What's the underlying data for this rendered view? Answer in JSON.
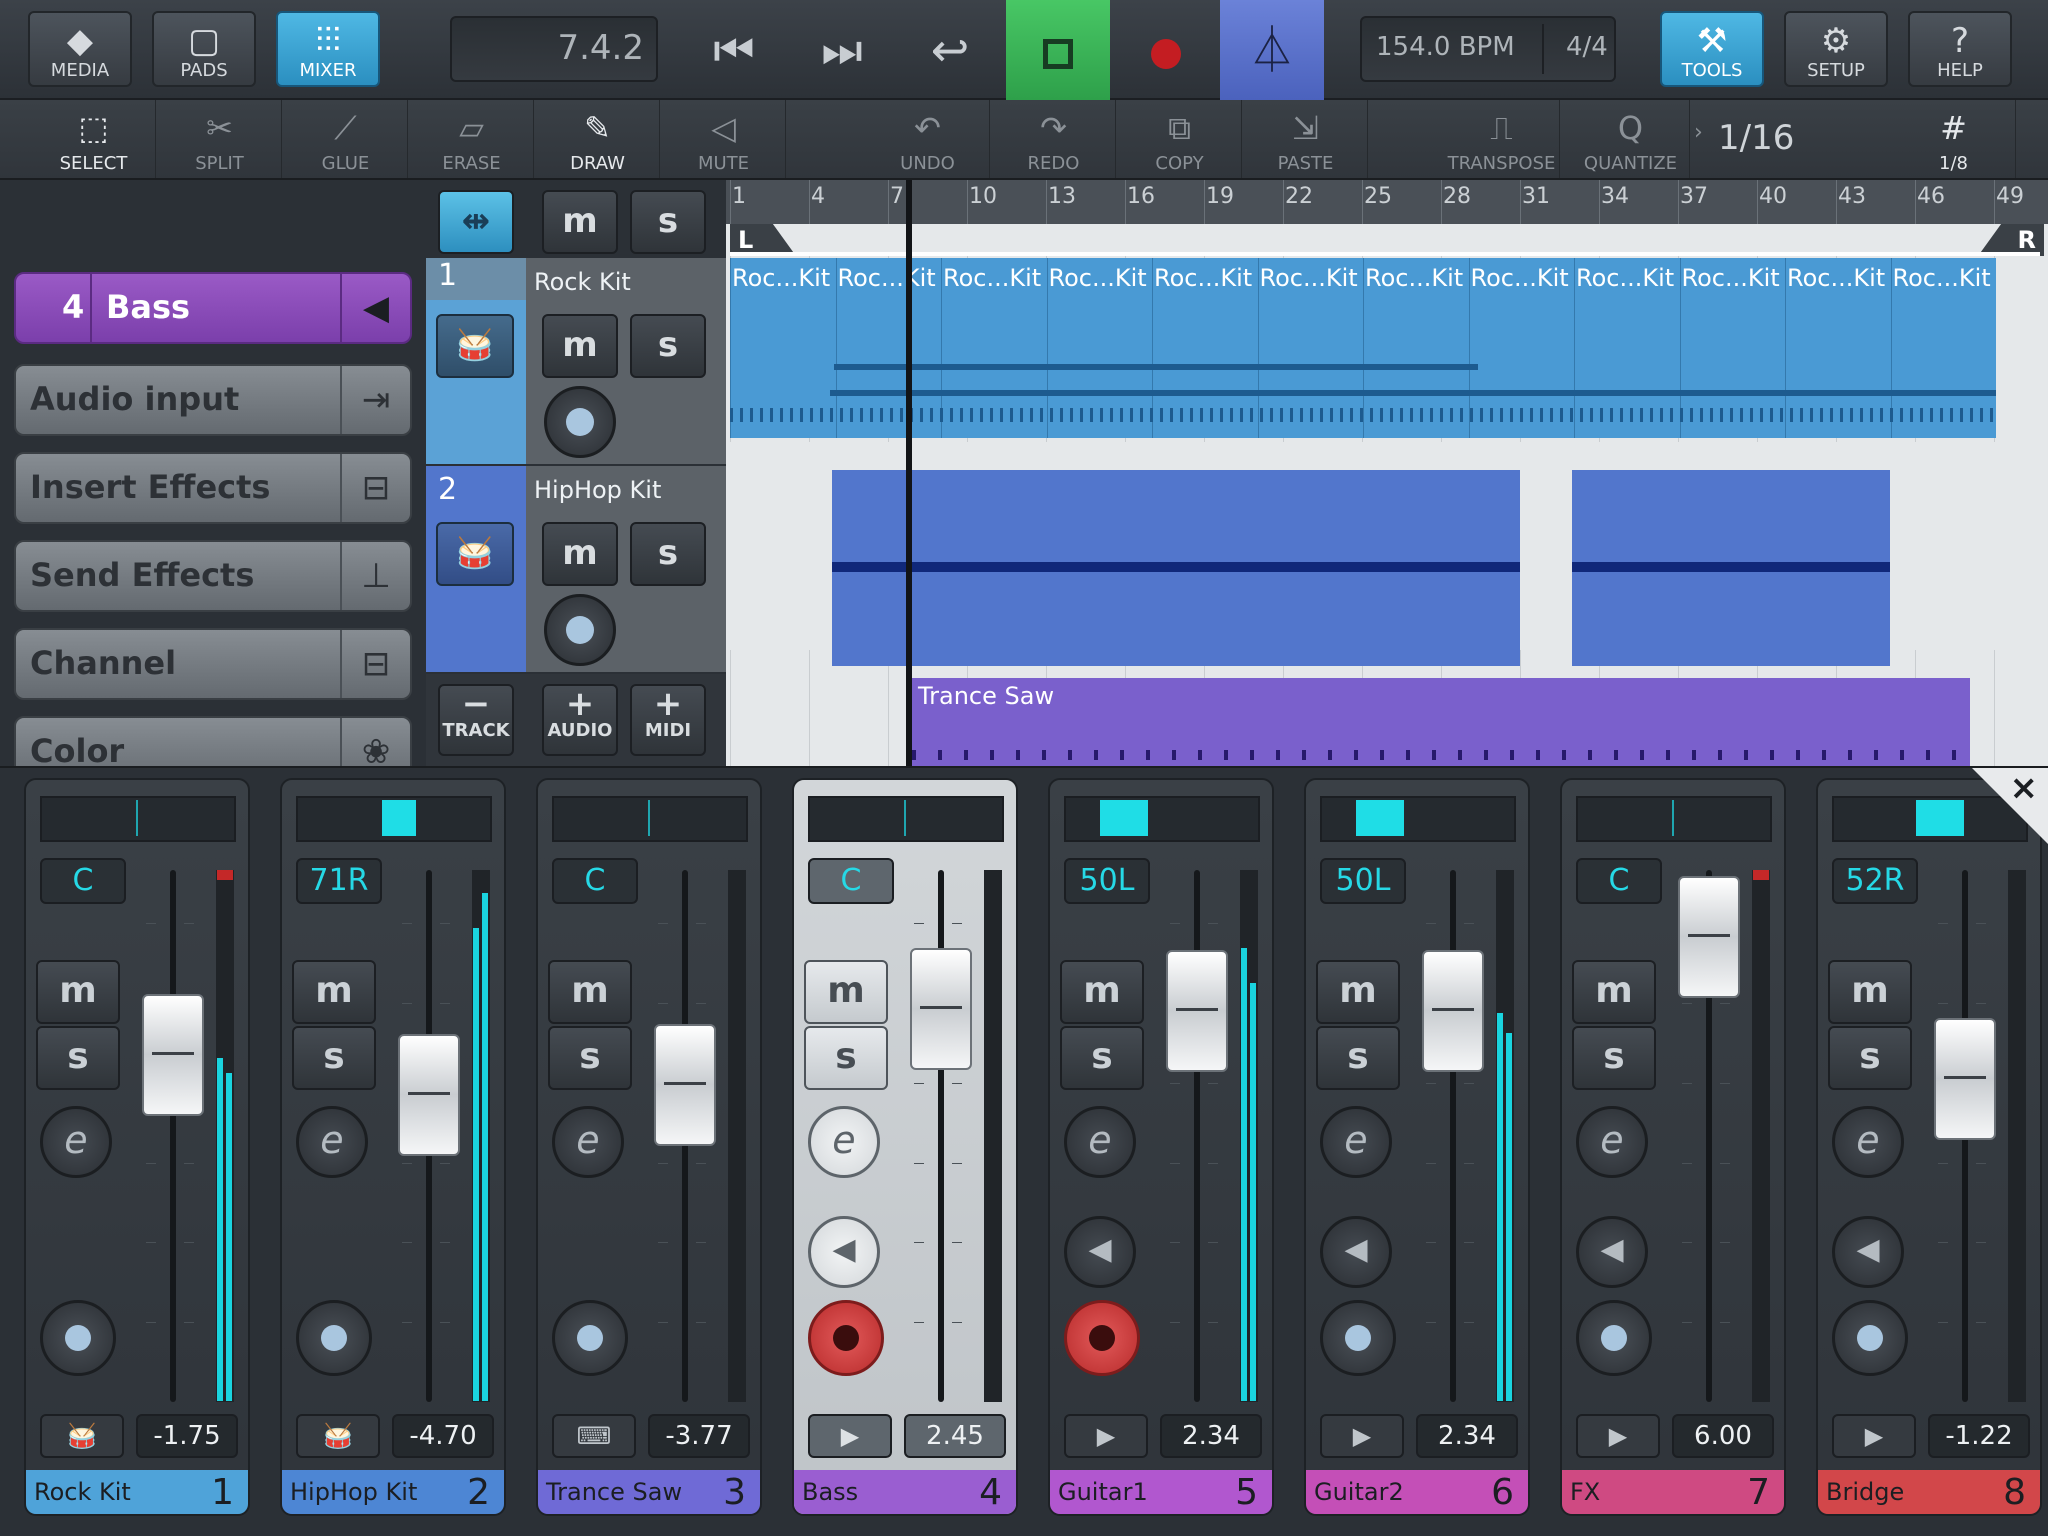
{
  "topbar": {
    "media_label": "MEDIA",
    "pads_label": "PADS",
    "mixer_label": "MIXER",
    "position": "7.4.2",
    "tempo": "154.0 BPM",
    "signature": "4/4",
    "tools_label": "TOOLS",
    "setup_label": "SETUP",
    "help_label": "HELP"
  },
  "toolbar": {
    "select": "SELECT",
    "split": "SPLIT",
    "glue": "GLUE",
    "erase": "ERASE",
    "draw": "DRAW",
    "mute": "MUTE",
    "undo": "UNDO",
    "redo": "REDO",
    "copy": "COPY",
    "paste": "PASTE",
    "transpose": "TRANSPOSE",
    "quantize": "QUANTIZE",
    "quantize_value": "1/16",
    "grid_value": "1/8"
  },
  "inspector": {
    "selected_number": "4",
    "selected_name": "Bass",
    "audio_input": "Audio input",
    "insert_effects": "Insert Effects",
    "send_effects": "Send Effects",
    "channel": "Channel",
    "color": "Color"
  },
  "track_headers": {
    "m": "m",
    "s": "s",
    "tracks": [
      {
        "num": "1",
        "name": "Rock Kit"
      },
      {
        "num": "2",
        "name": "HipHop Kit"
      }
    ],
    "track_label": "TRACK",
    "audio_label": "AUDIO",
    "midi_label": "MIDI"
  },
  "arrange": {
    "bars": [
      "1",
      "4",
      "7",
      "10",
      "13",
      "16",
      "19",
      "22",
      "25",
      "28",
      "31",
      "34",
      "37",
      "40",
      "43",
      "46",
      "49"
    ],
    "locator_left": "L",
    "locator_right": "R",
    "rock_region_label": "Roc...Kit",
    "trance_region_label": "Trance Saw",
    "colors": {
      "rock": "#4a9ad4",
      "hiphop": "#5276cc",
      "trance": "#7a60cc"
    }
  },
  "mixer": {
    "m": "m",
    "s": "s",
    "e": "e",
    "close": "×",
    "channels": [
      {
        "name": "Rock Kit",
        "num": "1",
        "pan": "C",
        "vol": "-1.75",
        "color": "#4fa3d9",
        "out": "drum",
        "speaker": false,
        "armed": false
      },
      {
        "name": "HipHop Kit",
        "num": "2",
        "pan": "71R",
        "vol": "-4.70",
        "color": "#4d86d4",
        "out": "drum",
        "speaker": false,
        "armed": false
      },
      {
        "name": "Trance Saw",
        "num": "3",
        "pan": "C",
        "vol": "-3.77",
        "color": "#6f6ad6",
        "out": "synth",
        "speaker": false,
        "armed": false
      },
      {
        "name": "Bass",
        "num": "4",
        "pan": "C",
        "vol": "2.45",
        "color": "#9a5ed1",
        "out": "play",
        "speaker": true,
        "armed": true
      },
      {
        "name": "Guitar1",
        "num": "5",
        "pan": "50L",
        "vol": "2.34",
        "color": "#b157cf",
        "out": "play",
        "speaker": true,
        "armed": true
      },
      {
        "name": "Guitar2",
        "num": "6",
        "pan": "50L",
        "vol": "2.34",
        "color": "#c44fb7",
        "out": "play",
        "speaker": true,
        "armed": false
      },
      {
        "name": "FX",
        "num": "7",
        "pan": "C",
        "vol": "6.00",
        "color": "#cf4a82",
        "out": "play",
        "speaker": true,
        "armed": false
      },
      {
        "name": "Bridge",
        "num": "8",
        "pan": "52R",
        "vol": "-1.22",
        "color": "#d2474a",
        "out": "play",
        "speaker": true,
        "armed": false
      }
    ]
  }
}
